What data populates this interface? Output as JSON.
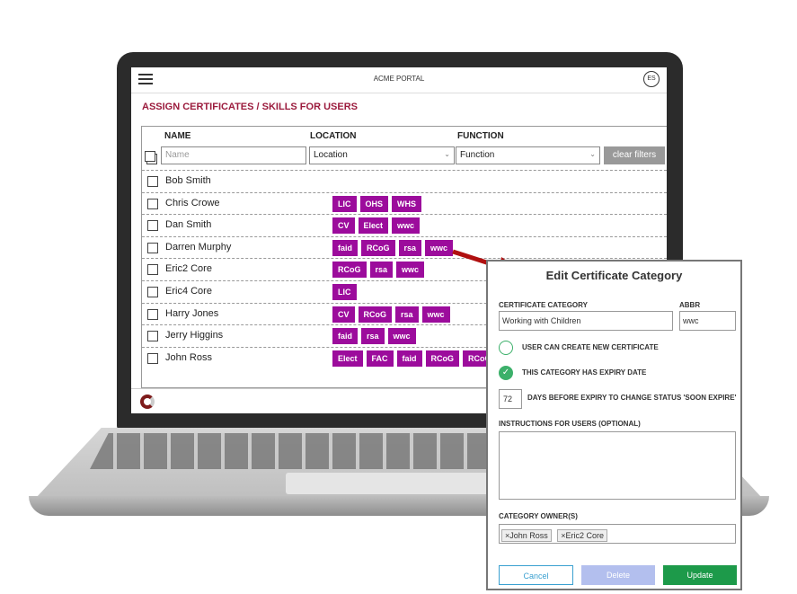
{
  "portal": {
    "app_title": "ACME PORTAL",
    "avatar_initials": "ES",
    "page_title": "ASSIGN CERTIFICATES / SKILLS FOR USERS",
    "columns": {
      "name": "NAME",
      "location": "LOCATION",
      "function": "FUNCTION"
    },
    "filters": {
      "name_placeholder": "Name",
      "location_value": "Location",
      "function_value": "Function",
      "clear_label": "clear filters"
    },
    "users": [
      {
        "name": "Bob Smith",
        "tags": []
      },
      {
        "name": "Chris Crowe",
        "tags": [
          "LIC",
          "OHS",
          "WHS"
        ]
      },
      {
        "name": "Dan Smith",
        "tags": [
          "CV",
          "Elect",
          "wwc"
        ]
      },
      {
        "name": "Darren Murphy",
        "tags": [
          "faid",
          "RCoG",
          "rsa",
          "wwc"
        ]
      },
      {
        "name": "Eric2 Core",
        "tags": [
          "RCoG",
          "rsa",
          "wwc"
        ]
      },
      {
        "name": "Eric4 Core",
        "tags": [
          "LIC"
        ]
      },
      {
        "name": "Harry Jones",
        "tags": [
          "CV",
          "RCoG",
          "rsa",
          "wwc"
        ]
      },
      {
        "name": "Jerry Higgins",
        "tags": [
          "faid",
          "rsa",
          "wwc"
        ]
      },
      {
        "name": "John Ross",
        "tags": [
          "Elect",
          "FAC",
          "faid",
          "RCoG",
          "RCoG"
        ]
      }
    ],
    "tag_color": "#9c0c9c"
  },
  "modal": {
    "title": "Edit Certificate Category",
    "category_label": "CERTIFICATE CATEGORY",
    "category_value": "Working with Children",
    "abbr_label": "ABBR",
    "abbr_value": "wwc",
    "option_create": "USER CAN CREATE NEW CERTIFICATE",
    "option_expiry": "THIS CATEGORY HAS EXPIRY DATE",
    "days_value": "72",
    "days_label": "DAYS BEFORE EXPIRY TO CHANGE STATUS 'SOON EXPIRE'",
    "instructions_label": "INSTRUCTIONS FOR USERS (OPTIONAL)",
    "owners_label": "CATEGORY OWNER(S)",
    "owners": [
      "×John Ross",
      "×Eric2 Core"
    ],
    "cancel_label": "Cancel",
    "delete_label": "Delete",
    "update_label": "Update"
  }
}
